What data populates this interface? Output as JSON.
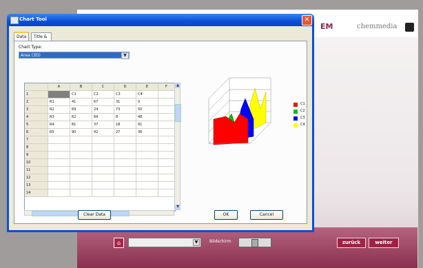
{
  "background": {
    "brand_fragment": "EM",
    "logo_text": "chemmedia",
    "footer": {
      "label": "Bildschirm",
      "back_label": "zurück",
      "next_label": "weiter"
    }
  },
  "dialog": {
    "title": "Chart Tool",
    "tabs": [
      "Data",
      "Title & Legend"
    ],
    "chart_type_label": "Chart Type:",
    "chart_type_value": "Area (3D)",
    "grid": {
      "columns": [
        "A",
        "B",
        "C",
        "D",
        "E",
        "F"
      ],
      "rows": [
        [
          "1",
          "",
          "C1",
          "C2",
          "C3",
          "C4",
          ""
        ],
        [
          "2",
          "R1",
          "41",
          "67",
          "31",
          "0",
          ""
        ],
        [
          "3",
          "R2",
          "69",
          "24",
          "73",
          "50",
          ""
        ],
        [
          "4",
          "R3",
          "62",
          "64",
          "8",
          "48",
          ""
        ],
        [
          "5",
          "R4",
          "81",
          "37",
          "18",
          "91",
          ""
        ],
        [
          "6",
          "R5",
          "90",
          "42",
          "27",
          "36",
          ""
        ],
        [
          "7",
          "",
          "",
          "",
          "",
          "",
          ""
        ],
        [
          "8",
          "",
          "",
          "",
          "",
          "",
          ""
        ],
        [
          "9",
          "",
          "",
          "",
          "",
          "",
          ""
        ],
        [
          "10",
          "",
          "",
          "",
          "",
          "",
          ""
        ],
        [
          "11",
          "",
          "",
          "",
          "",
          "",
          ""
        ],
        [
          "12",
          "",
          "",
          "",
          "",
          "",
          ""
        ],
        [
          "13",
          "",
          "",
          "",
          "",
          "",
          ""
        ],
        [
          "14",
          "",
          "",
          "",
          "",
          "",
          ""
        ]
      ]
    },
    "clear_label": "Clear Data",
    "ok_label": "OK",
    "cancel_label": "Cancel",
    "legend": [
      {
        "name": "C1",
        "color": "#ff0000"
      },
      {
        "name": "C2",
        "color": "#00c000"
      },
      {
        "name": "C3",
        "color": "#0000ff"
      },
      {
        "name": "C4",
        "color": "#ffff00"
      }
    ]
  }
}
